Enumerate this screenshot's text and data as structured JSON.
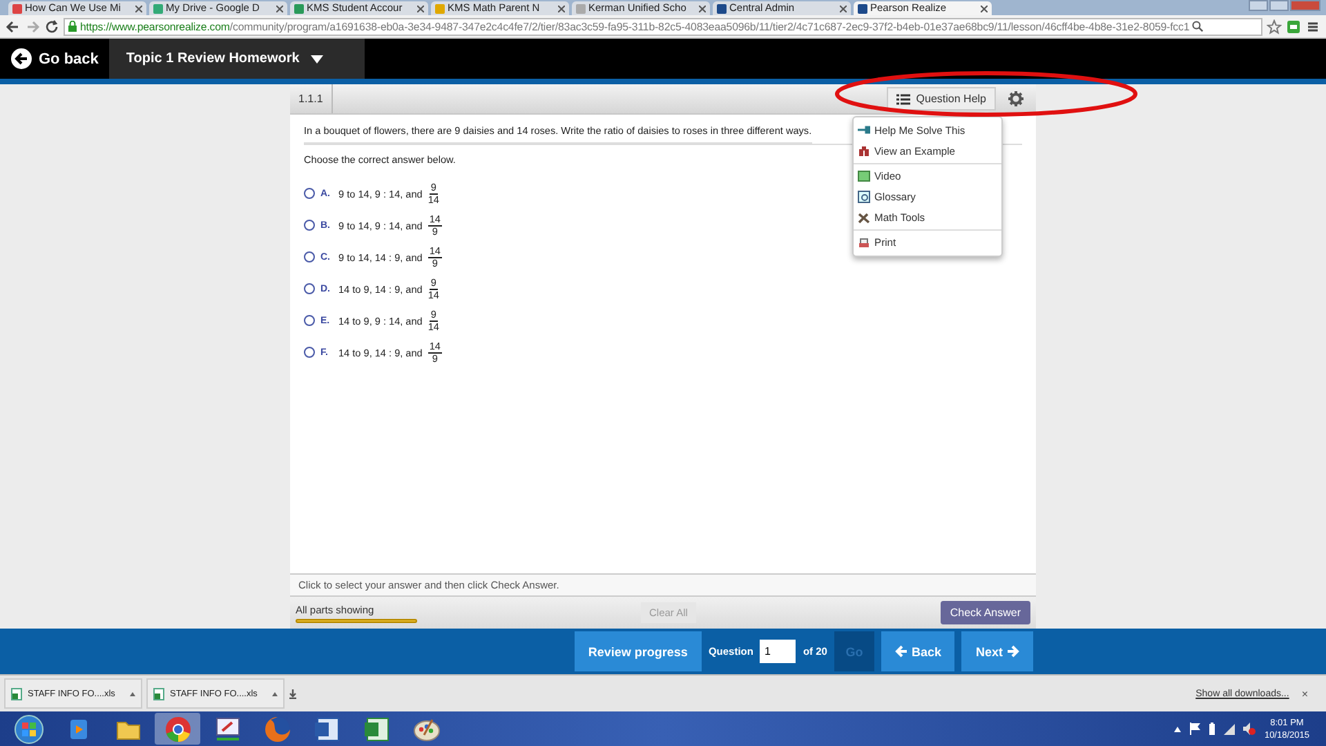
{
  "browser": {
    "tabs": [
      {
        "title": "How Can We Use Mi",
        "selected": false
      },
      {
        "title": "My Drive - Google D",
        "selected": false
      },
      {
        "title": "KMS Student Accour",
        "selected": false
      },
      {
        "title": "KMS Math Parent N",
        "selected": false
      },
      {
        "title": "Kerman Unified Scho",
        "selected": false
      },
      {
        "title": "Central Admin",
        "selected": false
      },
      {
        "title": "Pearson Realize",
        "selected": true
      }
    ],
    "url_host": "https://www.pearsonrealize.com",
    "url_path": "/community/program/a1691638-eb0a-3e34-9487-347e2c4c4fe7/2/tier/83ac3c59-fa95-311b-82c5-4083eaa5096b/11/tier2/4c71c687-2ec9-37f2-b4eb-01e37ae68bc9/11/lesson/46cff4be-4b8e-31e2-8059-fcc1"
  },
  "header": {
    "back_label": "Go back",
    "assignment": "Topic 1 Review Homework"
  },
  "question": {
    "number": "1.1.1",
    "help_label": "Question Help",
    "prompt": "In a bouquet of flowers, there are 9 daisies and 14 roses. Write the ratio of daisies to roses in three different ways.",
    "instruction": "Choose the correct answer below.",
    "choices": [
      {
        "letter": "A.",
        "text": "9 to 14, 9 : 14, and",
        "numerator": "9",
        "denominator": "14",
        "selected": false
      },
      {
        "letter": "B.",
        "text": "9 to 14, 9 : 14, and",
        "numerator": "14",
        "denominator": "9",
        "selected": false
      },
      {
        "letter": "C.",
        "text": "9 to 14, 14 : 9, and",
        "numerator": "14",
        "denominator": "9",
        "selected": false
      },
      {
        "letter": "D.",
        "text": "14 to 9, 14 : 9, and",
        "numerator": "9",
        "denominator": "14",
        "selected": false
      },
      {
        "letter": "E.",
        "text": "14 to 9, 9 : 14, and",
        "numerator": "9",
        "denominator": "14",
        "selected": false
      },
      {
        "letter": "F.",
        "text": "14 to 9, 14 : 9, and",
        "numerator": "14",
        "denominator": "9",
        "selected": false
      }
    ],
    "help_menu": {
      "expanded": true,
      "groups": [
        [
          {
            "label": "Help Me Solve This"
          },
          {
            "label": "View an Example"
          }
        ],
        [
          {
            "label": "Video"
          },
          {
            "label": "Glossary"
          },
          {
            "label": "Math Tools"
          }
        ],
        [
          {
            "label": "Print"
          }
        ]
      ]
    },
    "hint": "Click to select your answer and then click Check Answer.",
    "parts": {
      "label": "All parts showing",
      "level": 1
    },
    "clear_label": "Clear All",
    "clear_disabled": true,
    "check_label": "Check Answer"
  },
  "footer": {
    "review_label": "Review progress",
    "question_label": "Question",
    "question_value": "1",
    "of_label": "of 20",
    "go_label": "Go",
    "go_disabled": true,
    "back_label": "Back",
    "next_label": "Next"
  },
  "downloads": {
    "items": [
      {
        "name": "STAFF INFO FO....xls"
      },
      {
        "name": "STAFF INFO FO....xls"
      }
    ],
    "show_all": "Show all downloads...",
    "close": "×"
  },
  "taskbar": {
    "apps": [
      {
        "selected": false
      },
      {
        "selected": false
      },
      {
        "selected": true
      },
      {
        "selected": false
      },
      {
        "selected": false
      },
      {
        "selected": false
      },
      {
        "selected": false
      },
      {
        "selected": false
      }
    ],
    "time": "8:01 PM",
    "date": "10/18/2015"
  }
}
